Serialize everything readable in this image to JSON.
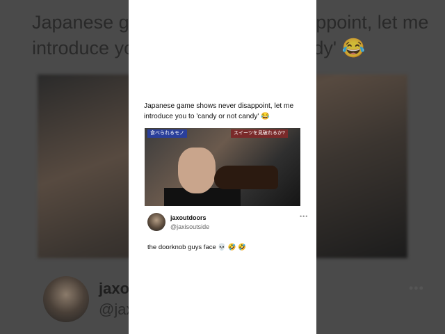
{
  "background": {
    "post_text": "Japanese game shows never disappoint, let me introduce you to 'candy or not candy' 😂",
    "author_name": "jaxo",
    "author_handle": "@jax",
    "more": "•••"
  },
  "post": {
    "text": "Japanese game shows never disappoint, let me introduce you to 'candy or not candy' 😂",
    "video": {
      "caption_left": "食べられるモノ",
      "caption_right": "スイーツを見破れるか?"
    }
  },
  "reply": {
    "author_name": "jaxoutdoors",
    "author_handle": "@jaxisoutside",
    "more": "•••",
    "text": "the doorknob guys face 💀 🤣 🤣"
  },
  "colors": {
    "card": "#ffffff",
    "backdrop": "#4a4a4a",
    "text": "#111111",
    "muted": "#666666"
  }
}
